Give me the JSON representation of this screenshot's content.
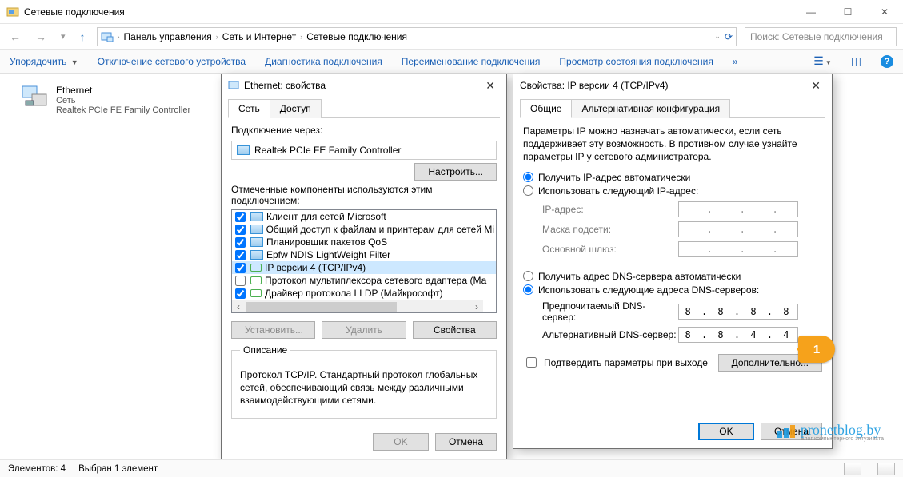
{
  "window": {
    "title": "Сетевые подключения"
  },
  "breadcrumb": {
    "root": "Панель управления",
    "mid": "Сеть и Интернет",
    "leaf": "Сетевые подключения"
  },
  "search": {
    "placeholder": "Поиск: Сетевые подключения"
  },
  "toolbar": {
    "organize": "Упорядочить",
    "disable": "Отключение сетевого устройства",
    "diag": "Диагностика подключения",
    "rename": "Переименование подключения",
    "status": "Просмотр состояния подключения",
    "more": "»"
  },
  "connection": {
    "name": "Ethernet",
    "network": "Сеть",
    "device": "Realtek PCIe FE Family Controller"
  },
  "dlg1": {
    "title": "Ethernet: свойства",
    "tabs": {
      "net": "Сеть",
      "share": "Доступ"
    },
    "conn_via": "Подключение через:",
    "adapter": "Realtek PCIe FE Family Controller",
    "configure": "Настроить...",
    "components_label": "Отмеченные компоненты используются этим подключением:",
    "items": [
      "Клиент для сетей Microsoft",
      "Общий доступ к файлам и принтерам для сетей Mi",
      "Планировщик пакетов QoS",
      "Epfw NDIS LightWeight Filter",
      "IP версии 4 (TCP/IPv4)",
      "Протокол мультиплексора сетевого адаптера (Ма",
      "Драйвер протокола LLDP (Майкрософт)"
    ],
    "install": "Установить...",
    "remove": "Удалить",
    "props": "Свойства",
    "desc_legend": "Описание",
    "desc_text": "Протокол TCP/IP. Стандартный протокол глобальных сетей, обеспечивающий связь между различными взаимодействующими сетями.",
    "ok": "OK",
    "cancel": "Отмена"
  },
  "dlg2": {
    "title": "Свойства: IP версии 4 (TCP/IPv4)",
    "tabs": {
      "general": "Общие",
      "alt": "Альтернативная конфигурация"
    },
    "intro": "Параметры IP можно назначать автоматически, если сеть поддерживает эту возможность. В противном случае узнайте параметры IP у сетевого администратора.",
    "ip_auto": "Получить IP-адрес автоматически",
    "ip_manual": "Использовать следующий IP-адрес:",
    "ip_label": "IP-адрес:",
    "mask_label": "Маска подсети:",
    "gw_label": "Основной шлюз:",
    "dns_auto": "Получить адрес DNS-сервера автоматически",
    "dns_manual": "Использовать следующие адреса DNS-серверов:",
    "dns1_label": "Предпочитаемый DNS-сервер:",
    "dns2_label": "Альтернативный DNS-сервер:",
    "dns1": "8 . 8 . 8 . 8",
    "dns2": "8 . 8 . 4 . 4",
    "validate": "Подтвердить параметры при выходе",
    "advanced": "Дополнительно...",
    "ok": "OK",
    "cancel": "Отмена"
  },
  "statusbar": {
    "count": "Элементов: 4",
    "sel": "Выбран 1 элемент"
  },
  "annotation": {
    "n": "1"
  },
  "logo": {
    "text": "pronetblog.by",
    "sub": "Блог компьютерного энтузиаста"
  }
}
